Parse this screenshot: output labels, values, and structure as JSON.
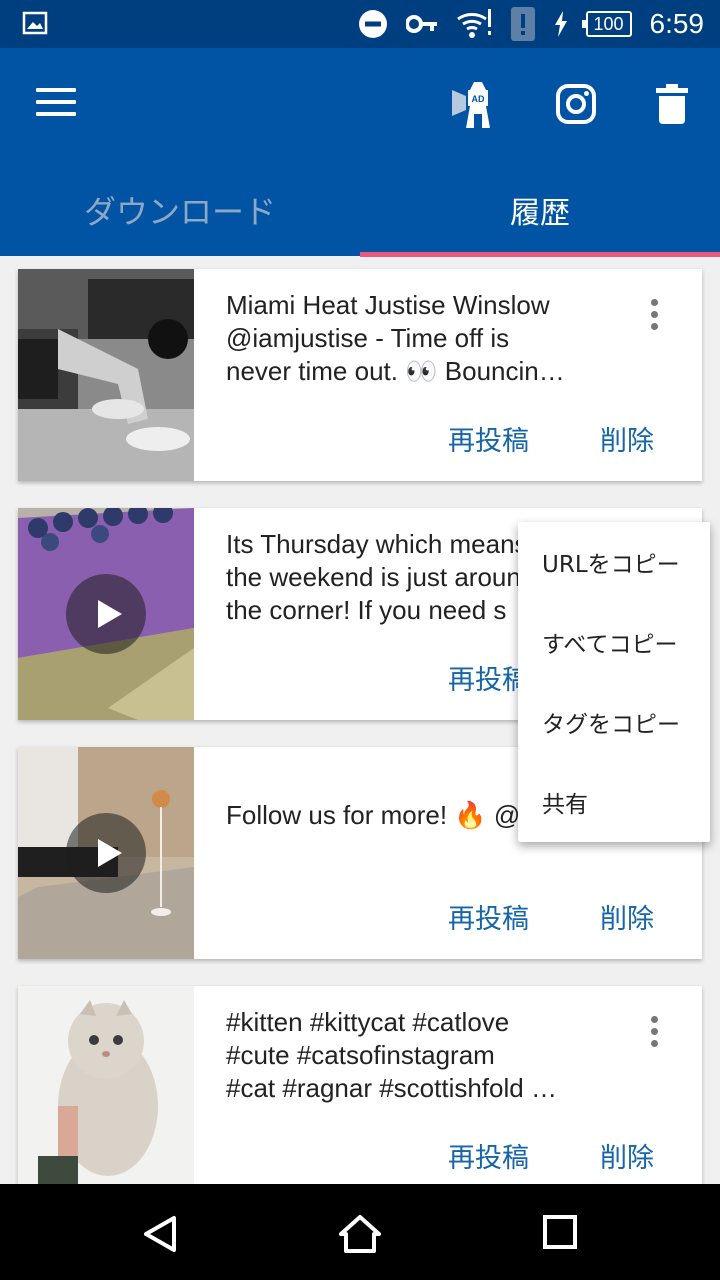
{
  "status_bar": {
    "icons": [
      "gallery-icon",
      "do-not-disturb-icon",
      "key-icon",
      "wifi-icon",
      "alert-icon",
      "charging-icon"
    ],
    "battery": "100",
    "time": "6:59"
  },
  "app_bar": {
    "icons": [
      "menu-icon",
      "ad-lighthouse-icon",
      "instagram-icon",
      "trash-icon"
    ],
    "tabs": [
      {
        "label": "ダウンロード"
      },
      {
        "label": "履歴"
      }
    ],
    "colors": {
      "primary": "#0054a3",
      "status": "#003f7f",
      "indicator": "#e8577f",
      "accent_text": "#1565a8"
    }
  },
  "posts": [
    {
      "caption": "Miami Heat Justise Winslow\n@iamjustise - Time off is\nnever time out. 👀 Bouncin…",
      "is_video": false
    },
    {
      "caption": "Its Thursday which means\nthe weekend is just around\nthe corner! If you need s",
      "is_video": true
    },
    {
      "caption": "Follow us for more! 🔥 @",
      "is_video": true
    },
    {
      "caption": "#kitten #kittycat #catlove\n#cute #catsofinstagram\n#cat #ragnar #scottishfold …",
      "is_video": false
    }
  ],
  "actions": {
    "repost": "再投稿",
    "delete": "削除"
  },
  "context_menu": {
    "items": [
      "URLをコピー",
      "すべてコピー",
      "タグをコピー",
      "共有"
    ]
  },
  "nav_bar": {
    "icons": [
      "back-icon",
      "home-icon",
      "recents-icon"
    ]
  }
}
